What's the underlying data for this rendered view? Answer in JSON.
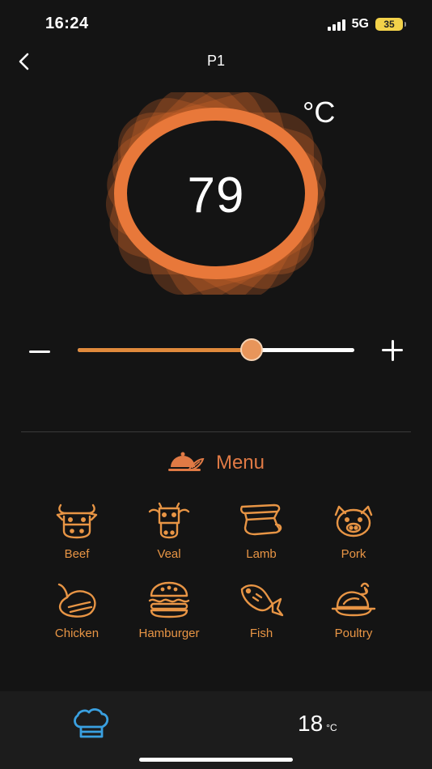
{
  "status_bar": {
    "time": "16:24",
    "network": "5G",
    "battery": "35"
  },
  "nav": {
    "title": "P1"
  },
  "gauge": {
    "value": "79",
    "unit": "°C",
    "accent_color": "#e8783a"
  },
  "slider": {
    "fraction": 0.63,
    "fill_color": "#e08a3c",
    "track_color": "#ffffff"
  },
  "menu": {
    "title": "Menu",
    "items": [
      {
        "label": "Beef",
        "icon": "beef-icon"
      },
      {
        "label": "Veal",
        "icon": "veal-icon"
      },
      {
        "label": "Lamb",
        "icon": "lamb-icon"
      },
      {
        "label": "Pork",
        "icon": "pork-icon"
      },
      {
        "label": "Chicken",
        "icon": "chicken-icon"
      },
      {
        "label": "Hamburger",
        "icon": "hamburger-icon"
      },
      {
        "label": "Fish",
        "icon": "fish-icon"
      },
      {
        "label": "Poultry",
        "icon": "poultry-icon"
      }
    ]
  },
  "bottom_bar": {
    "temperature": "18",
    "unit": "°C",
    "chef_icon_color": "#3aa0e0"
  }
}
